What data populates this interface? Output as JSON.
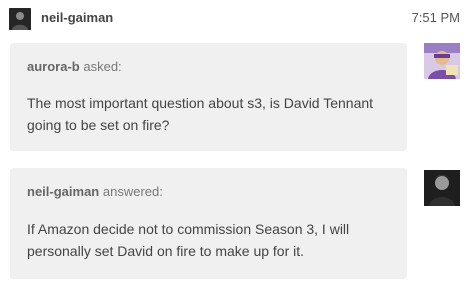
{
  "header": {
    "username": "neil-gaiman",
    "time": "7:51 PM"
  },
  "question": {
    "asker": "aurora-b",
    "verb": "asked:",
    "text": "The most important question about s3, is David Tennant going to be set on fire?"
  },
  "answer": {
    "answerer": "neil-gaiman",
    "verb": "answered:",
    "text": "If Amazon decide not to commission Season 3, I will personally set David on fire to make up for it."
  },
  "colors": {
    "bubble": "#f0f0f0",
    "text": "#444444",
    "muted": "#777777"
  },
  "icons": {
    "header_avatar": "user-avatar-icon",
    "asker_avatar": "asker-avatar-icon",
    "answerer_avatar": "answerer-avatar-icon"
  }
}
